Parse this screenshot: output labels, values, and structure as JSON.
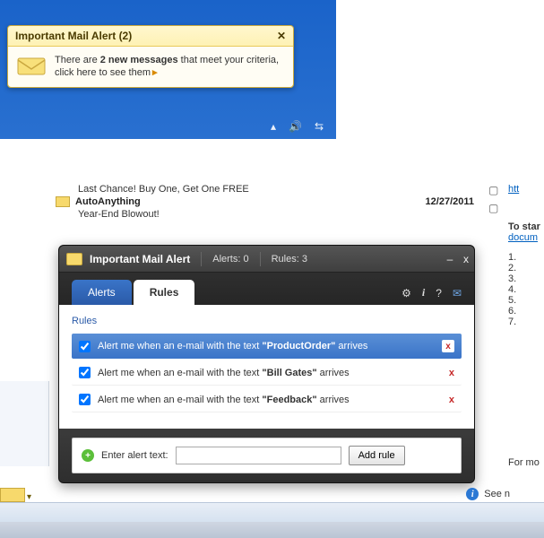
{
  "toast": {
    "title": "Important Mail Alert (2)",
    "msg_prefix": "There are ",
    "msg_bold": "2 new messages",
    "msg_mid": " that meet your criteria, click here to see them",
    "arrow": "▸"
  },
  "tray": {
    "up": "▴",
    "vol": "🔊",
    "net": "⇆"
  },
  "mail": {
    "line1": "Last Chance! Buy One, Get One FREE",
    "sender": "AutoAnything",
    "date": "12/27/2011",
    "subj2": "Year-End Blowout!"
  },
  "panel": {
    "title": "Important Mail Alert",
    "alerts": "Alerts: 0",
    "rules": "Rules: 3",
    "min": "–",
    "close": "x",
    "tabs": {
      "alerts": "Alerts",
      "rules": "Rules"
    },
    "icons": {
      "gear": "⚙",
      "info": "i",
      "help": "?",
      "mail": "✉"
    },
    "section": "Rules",
    "rows": [
      {
        "prefix": "Alert me when an e-mail with the text ",
        "bold": "\"ProductOrder\"",
        "suffix": " arrives"
      },
      {
        "prefix": "Alert me when an e-mail with the text ",
        "bold": "\"Bill Gates\"",
        "suffix": " arrives"
      },
      {
        "prefix": "Alert me when an e-mail with the text ",
        "bold": "\"Feedback\"",
        "suffix": " arrives"
      }
    ],
    "del": "x",
    "footer": {
      "label": "Enter alert text:",
      "button": "Add rule",
      "placeholder": ""
    }
  },
  "right": {
    "htt": "htt",
    "tostar": "To star",
    "docum": "docum",
    "nums": [
      "1.",
      "2.",
      "3.",
      "4.",
      "5.",
      "6.",
      "7."
    ],
    "formo": "For mo",
    "seen": "See n"
  }
}
